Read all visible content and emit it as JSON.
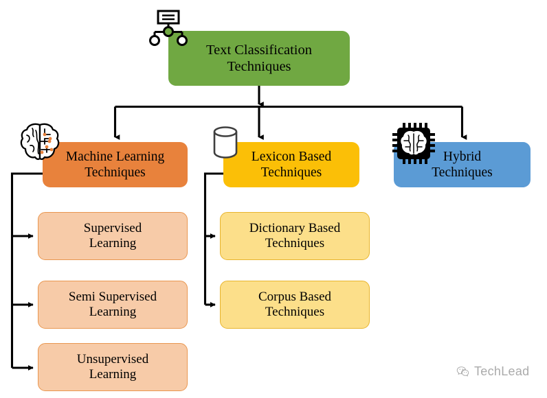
{
  "diagram": {
    "title": "Text Classification Techniques",
    "type": "hierarchy-tree",
    "root": {
      "id": "root",
      "label": "Text Classification\nTechniques",
      "color": "#70A842",
      "icon": "hierarchy-icon"
    },
    "branches": [
      {
        "id": "machine-learning",
        "label": "Machine Learning\nTechniques",
        "color": "#E8823C",
        "icon": "brain-icon",
        "children": [
          {
            "id": "supervised-learning",
            "label": "Supervised\nLearning",
            "color": "#F7CBA8",
            "border": "#E9964F"
          },
          {
            "id": "semi-supervised-learning",
            "label": "Semi Supervised\nLearning",
            "color": "#F7CBA8",
            "border": "#E9964F"
          },
          {
            "id": "unsupervised-learning",
            "label": "Unsupervised\nLearning",
            "color": "#F7CBA8",
            "border": "#E9964F"
          }
        ]
      },
      {
        "id": "lexicon-based",
        "label": "Lexicon Based\nTechniques",
        "color": "#FBBF07",
        "icon": "database-icon",
        "children": [
          {
            "id": "dictionary-based-techniques",
            "label": "Dictionary Based\nTechniques",
            "color": "#FCDF8A",
            "border": "#E8B42C"
          },
          {
            "id": "corpus-based-techniques",
            "label": "Corpus Based\nTechniques",
            "color": "#FCDF8A",
            "border": "#E8B42C"
          }
        ]
      },
      {
        "id": "hybrid",
        "label": "Hybrid\nTechniques",
        "color": "#5B9BD5",
        "icon": "chip-brain-icon",
        "children": []
      }
    ],
    "connector_color": "#000000"
  },
  "watermark": {
    "text": "TechLead",
    "icon": "wechat-icon",
    "color": "#8a8a8a"
  }
}
